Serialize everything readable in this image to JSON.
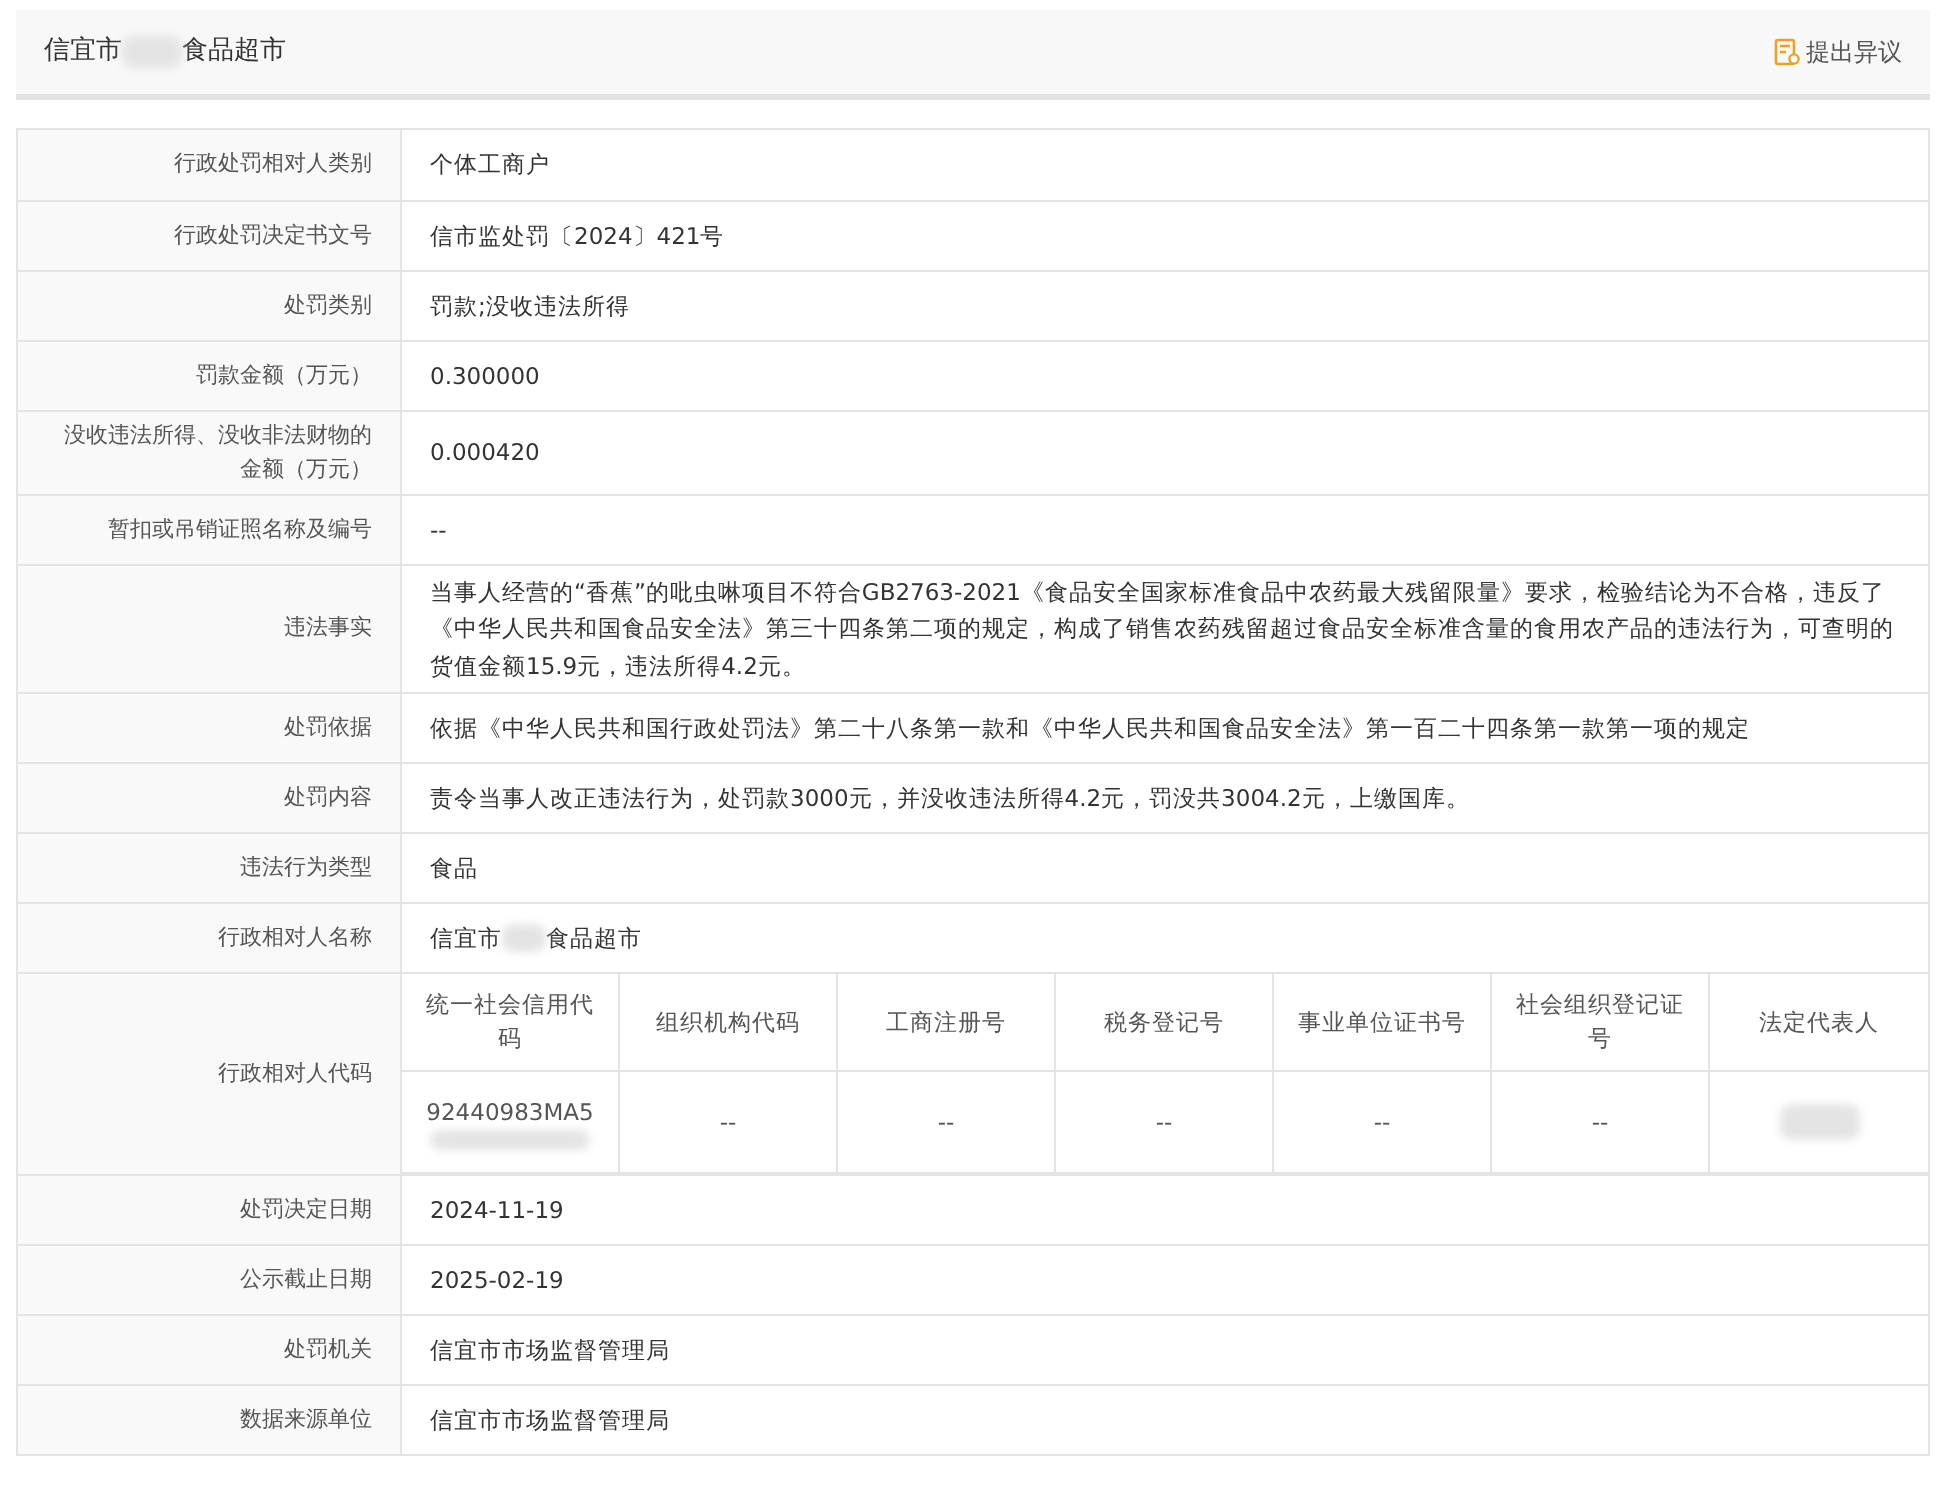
{
  "header": {
    "title_start": "信宜市",
    "title_redacted": true,
    "title_end": "食品超市",
    "action": "提出异议"
  },
  "rows": [
    {
      "kind": "text",
      "label": "行政处罚相对人类别",
      "value": "个体工商户"
    },
    {
      "kind": "text",
      "label": "行政处罚决定书文号",
      "value": "信市监处罚〔2024〕421号"
    },
    {
      "kind": "text",
      "label": "处罚类别",
      "value": "罚款;没收违法所得"
    },
    {
      "kind": "text",
      "label": "罚款金额（万元）",
      "value": "0.300000"
    },
    {
      "kind": "text",
      "label": "没收违法所得、没收非法财物的金额（万元）",
      "value": "0.000420"
    },
    {
      "kind": "text",
      "label": "暂扣或吊销证照名称及编号",
      "value": "--"
    },
    {
      "kind": "text",
      "label": "违法事实",
      "value": "当事人经营的“香蕉”的吡虫啉项目不符合GB2763-2021《食品安全国家标准食品中农药最大残留限量》要求，检验结论为不合格，违反了《中华人民共和国食品安全法》第三十四条第二项的规定，构成了销售农药残留超过食品安全标准含量的食用农产品的违法行为，可查明的货值金额15.9元，违法所得4.2元。"
    },
    {
      "kind": "text",
      "label": "处罚依据",
      "value": "依据《中华人民共和国行政处罚法》第二十八条第一款和《中华人民共和国食品安全法》第一百二十四条第一款第一项的规定"
    },
    {
      "kind": "text",
      "label": "处罚内容",
      "value": "责令当事人改正违法行为，处罚款3000元，并没收违法所得4.2元，罚没共3004.2元，上缴国库。"
    },
    {
      "kind": "text",
      "label": "违法行为类型",
      "value": "食品"
    },
    {
      "kind": "redacted_name",
      "label": "行政相对人名称",
      "value_start": "信宜市",
      "value_end": "食品超市"
    },
    {
      "kind": "codes",
      "label": "行政相对人代码",
      "columns": [
        "统一社会信用代码",
        "组织机构代码",
        "工商注册号",
        "税务登记号",
        "事业单位证书号",
        "社会组织登记证号",
        "法定代表人"
      ],
      "cells": [
        {
          "value": "92440983MA5",
          "redacted": true
        },
        {
          "value": "--",
          "redacted": false
        },
        {
          "value": "--",
          "redacted": false
        },
        {
          "value": "--",
          "redacted": false
        },
        {
          "value": "--",
          "redacted": false
        },
        {
          "value": "--",
          "redacted": false
        },
        {
          "redacted": true
        }
      ]
    },
    {
      "kind": "text",
      "label": "处罚决定日期",
      "value": "2024-11-19"
    },
    {
      "kind": "text",
      "label": "公示截止日期",
      "value": "2025-02-19"
    },
    {
      "kind": "text",
      "label": "处罚机关",
      "value": "信宜市市场监督管理局"
    },
    {
      "kind": "text",
      "label": "数据来源单位",
      "value": "信宜市市场监督管理局"
    }
  ]
}
